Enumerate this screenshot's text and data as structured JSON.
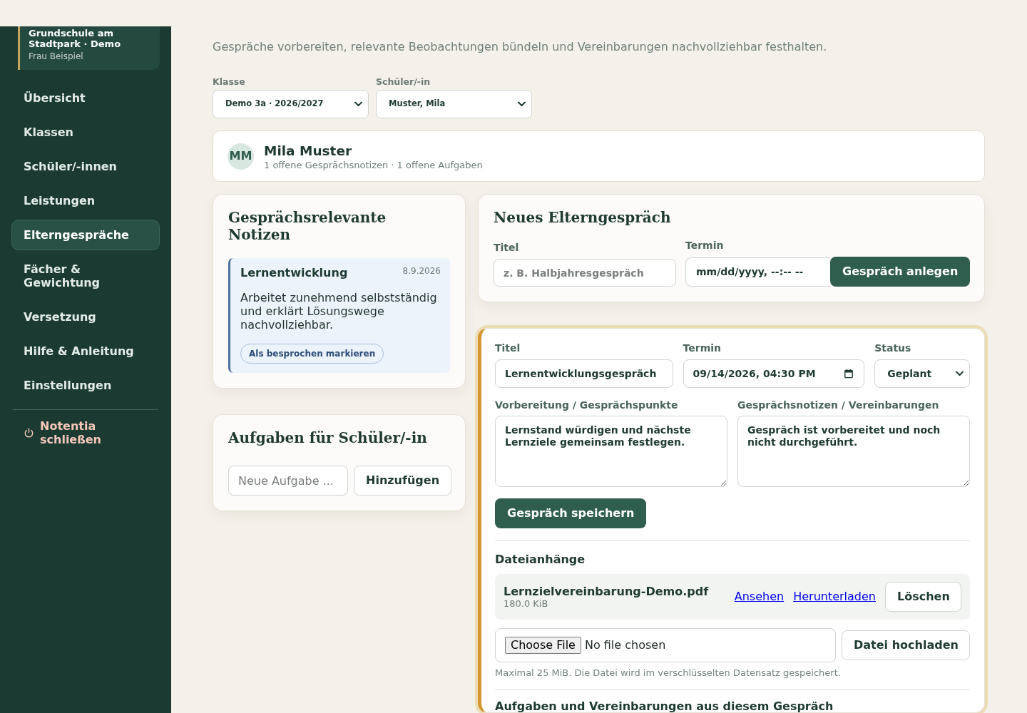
{
  "sidebar": {
    "school": "Grundschule am Stadtpark · Demo",
    "teacher": "Frau Beispiel",
    "items": [
      {
        "label": "Übersicht",
        "selected": false
      },
      {
        "label": "Klassen",
        "selected": false
      },
      {
        "label": "Schüler/-innen",
        "selected": false
      },
      {
        "label": "Leistungen",
        "selected": false
      },
      {
        "label": "Elterngespräche",
        "selected": true
      },
      {
        "label": "Fächer & Gewichtung",
        "selected": false
      },
      {
        "label": "Versetzung",
        "selected": false
      },
      {
        "label": "Hilfe & Anleitung",
        "selected": false
      },
      {
        "label": "Einstellungen",
        "selected": false
      }
    ],
    "exit": "Notentia schließen"
  },
  "page": {
    "subtitle": "Gespräche vorbereiten, relevante Beobachtungen bündeln und Vereinbarungen nachvollziehbar festhalten."
  },
  "filters": [
    {
      "label": "Klasse",
      "value": "Demo 3a · 2026/2027"
    },
    {
      "label": "Schüler/-in",
      "value": "Muster, Mila"
    }
  ],
  "student": {
    "initials": "MM",
    "name": "Mila Muster",
    "summary": "1 offene Gesprächsnotizen · 1 offene Aufgaben"
  },
  "notes_panel": {
    "title": "Gesprächsrelevante Notizen",
    "notes": [
      {
        "category": "Lernentwicklung",
        "date": "8.9.2026",
        "text": "Arbeitet zunehmend selbstständig und erklärt Lösungswege nachvollziehbar.",
        "action": "Als besprochen markieren"
      }
    ]
  },
  "tasks_panel": {
    "title": "Aufgaben für Schüler/-in",
    "input": {
      "placeholder": "Neue Aufgabe ..."
    },
    "button": "Hinzufügen"
  },
  "new_meeting": {
    "title": "Neues Elterngespräch",
    "title_field": {
      "label": "Titel",
      "placeholder": "z. B. Halbjahresgespräch"
    },
    "date_field": {
      "label": "Termin",
      "placeholder": "mm/dd/yyyy, --:-- --"
    },
    "button": "Gespräch anlegen"
  },
  "meetings": [
    {
      "selected": true,
      "fields": [
        {
          "kind": "text",
          "label": "Titel",
          "value": "Lernentwicklungsgespräch"
        },
        {
          "kind": "datetime",
          "label": "Termin",
          "value": "09/14/2026, 04:30 PM"
        },
        {
          "kind": "select",
          "label": "Status",
          "value": "Geplant"
        }
      ],
      "notes": [
        {
          "label": "Vorbereitung / Gesprächspunkte",
          "value": "Lernstand würdigen und nächste Lernziele gemeinsam festlegen."
        },
        {
          "label": "Gesprächsnotizen / Vereinbarungen",
          "value": "Gespräch ist vorbereitet und noch nicht durchgeführt."
        }
      ],
      "save_button": "Gespräch speichern",
      "attachments": {
        "title": "Dateianhänge",
        "files": [
          {
            "name": "Lernzielvereinbarung-Demo.pdf",
            "size": "180.0 KiB",
            "links": [
              "Ansehen",
              "Herunterladen"
            ],
            "delete_button": "Löschen"
          }
        ],
        "upload": {
          "choose_button": "Choose File",
          "status": "No file chosen",
          "button": "Datei hochladen",
          "hint": "Maximal 25 MiB. Die Datei wird im verschlüsselten Datensatz gespeichert."
        }
      },
      "tasks_title": "Aufgaben und Vereinbarungen aus diesem Gespräch"
    }
  ]
}
